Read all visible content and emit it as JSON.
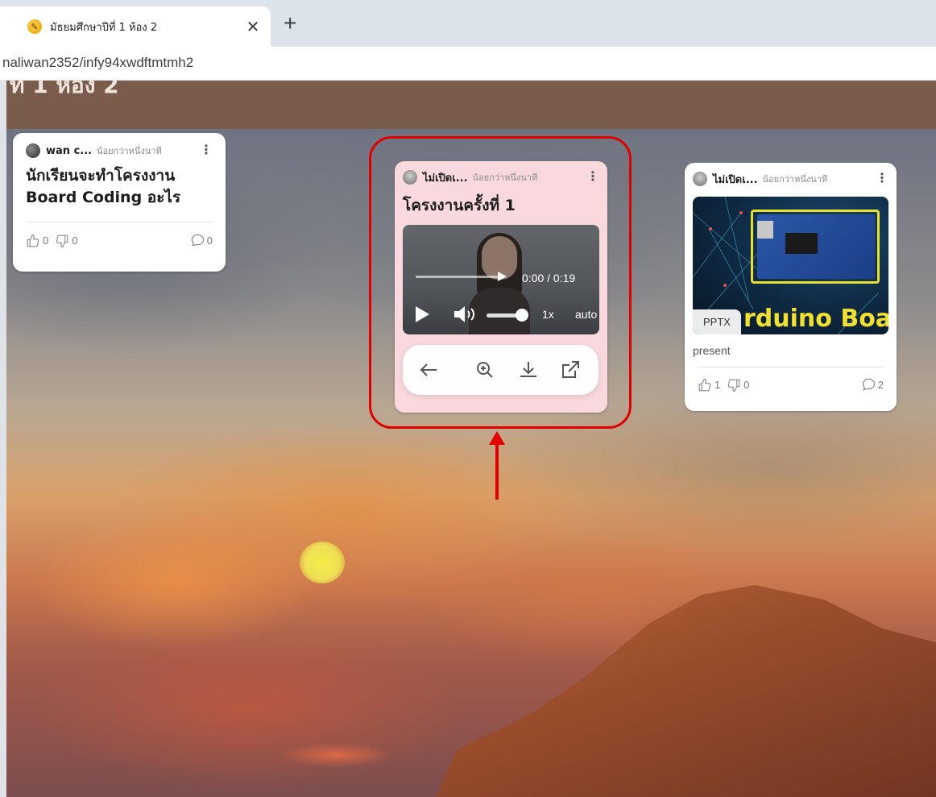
{
  "browser": {
    "tab_title": "มัธยมศึกษาปีที่ 1 ห้อง 2",
    "close_symbol": "✕",
    "new_tab_symbol": "+",
    "url": "naliwan2352/infy94xwdftmtmh2"
  },
  "padlet": {
    "header_title": "ท 1 ห้อง 2",
    "header_color": "#7a5c4c"
  },
  "cards": [
    {
      "author": "wan c...",
      "time": "น้อยกว่าหนึ่งนาที",
      "title": "นักเรียนจะทำโครงงาน Board Coding อะไร",
      "likes": "0",
      "dislikes": "0",
      "comments": "0"
    },
    {
      "author": "ไม่เปิดเ...",
      "time": "น้อยกว่าหนึ่งนาที",
      "title": "โครงงานครั้งที่ 1",
      "background": "#f9d9dd",
      "video": {
        "time": "0:00 / 0:19",
        "speed": "1x",
        "quality": "auto",
        "progress": 0,
        "volume": 0.8
      },
      "toolbar": [
        "back-arrow-icon",
        "zoom-in-icon",
        "download-icon",
        "open-external-icon"
      ]
    },
    {
      "author": "ไม่เปิดเ...",
      "time": "น้อยกว่าหนึ่งนาที",
      "thumbnail_text": "rduino Boar",
      "file_badge": "PPTX",
      "description": "present",
      "likes": "1",
      "dislikes": "0",
      "comments": "2"
    }
  ],
  "annotation": {
    "color": "#e10000"
  }
}
